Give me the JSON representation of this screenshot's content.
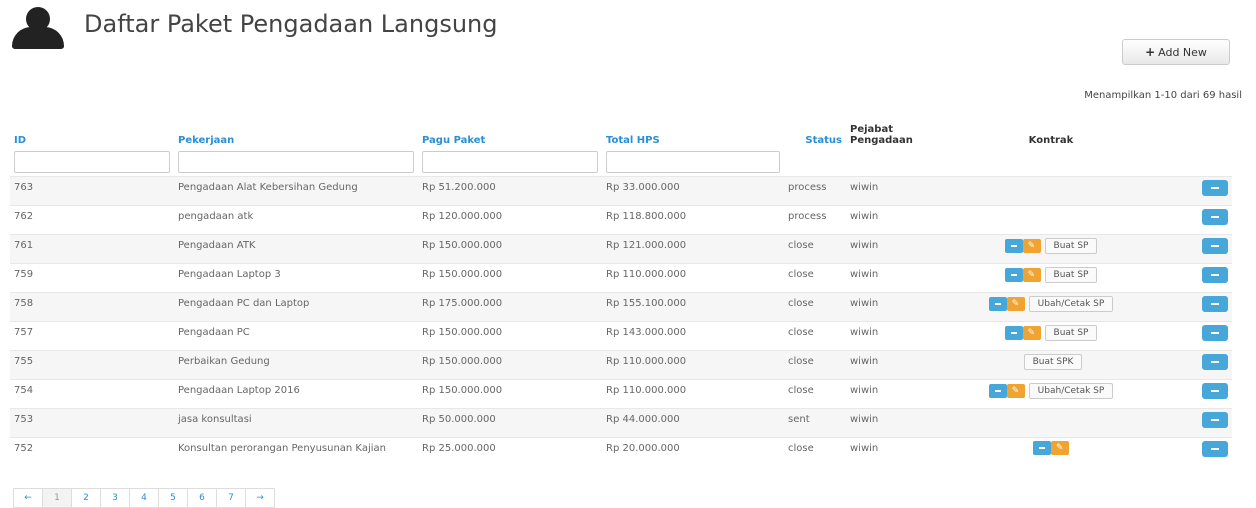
{
  "header": {
    "title": "Daftar Paket Pengadaan Langsung",
    "icon": "user-icon"
  },
  "actions": {
    "add_label": "Add New",
    "add_icon": "+"
  },
  "summary": "Menampilkan 1-10 dari 69 hasil",
  "columns": {
    "id": "ID",
    "pekerjaan": "Pekerjaan",
    "pagu": "Pagu Paket",
    "hps": "Total HPS",
    "status": "Status",
    "pejabat": "Pejabat Pengadaan",
    "kontrak": "Kontrak"
  },
  "rows": [
    {
      "id": "763",
      "pekerjaan": "Pengadaan Alat Kebersihan Gedung",
      "pagu": "Rp 51.200.000",
      "hps": "Rp 33.000.000",
      "status": "process",
      "pejabat": "wiwin",
      "kontrak": ""
    },
    {
      "id": "762",
      "pekerjaan": "pengadaan atk",
      "pagu": "Rp 120.000.000",
      "hps": "Rp 118.800.000",
      "status": "process",
      "pejabat": "wiwin",
      "kontrak": ""
    },
    {
      "id": "761",
      "pekerjaan": "Pengadaan ATK",
      "pagu": "Rp 150.000.000",
      "hps": "Rp 121.000.000",
      "status": "close",
      "pejabat": "wiwin",
      "kontrak": "Buat SP"
    },
    {
      "id": "759",
      "pekerjaan": "Pengadaan Laptop 3",
      "pagu": "Rp 150.000.000",
      "hps": "Rp 110.000.000",
      "status": "close",
      "pejabat": "wiwin",
      "kontrak": "Buat SP"
    },
    {
      "id": "758",
      "pekerjaan": "Pengadaan PC dan Laptop",
      "pagu": "Rp 175.000.000",
      "hps": "Rp 155.100.000",
      "status": "close",
      "pejabat": "wiwin",
      "kontrak": "Ubah/Cetak SP"
    },
    {
      "id": "757",
      "pekerjaan": "Pengadaan PC",
      "pagu": "Rp 150.000.000",
      "hps": "Rp 143.000.000",
      "status": "close",
      "pejabat": "wiwin",
      "kontrak": "Buat SP"
    },
    {
      "id": "755",
      "pekerjaan": "Perbaikan Gedung",
      "pagu": "Rp 150.000.000",
      "hps": "Rp 110.000.000",
      "status": "close",
      "pejabat": "wiwin",
      "kontrak": "Buat SPK"
    },
    {
      "id": "754",
      "pekerjaan": "Pengadaan Laptop 2016",
      "pagu": "Rp 150.000.000",
      "hps": "Rp 110.000.000",
      "status": "close",
      "pejabat": "wiwin",
      "kontrak": "Ubah/Cetak SP"
    },
    {
      "id": "753",
      "pekerjaan": "jasa konsultasi",
      "pagu": "Rp 50.000.000",
      "hps": "Rp 44.000.000",
      "status": "sent",
      "pejabat": "wiwin",
      "kontrak": ""
    },
    {
      "id": "752",
      "pekerjaan": "Konsultan perorangan Penyusunan Kajian",
      "pagu": "Rp 25.000.000",
      "hps": "Rp 20.000.000",
      "status": "close",
      "pejabat": "wiwin",
      "kontrak": ""
    }
  ],
  "pagination": {
    "prev": "←",
    "pages": [
      "1",
      "2",
      "3",
      "4",
      "5",
      "6",
      "7"
    ],
    "next": "→",
    "active": "1"
  },
  "colors": {
    "link": "#2a8fd6",
    "blue_button": "#46a7d8",
    "orange_button": "#f0a330"
  }
}
